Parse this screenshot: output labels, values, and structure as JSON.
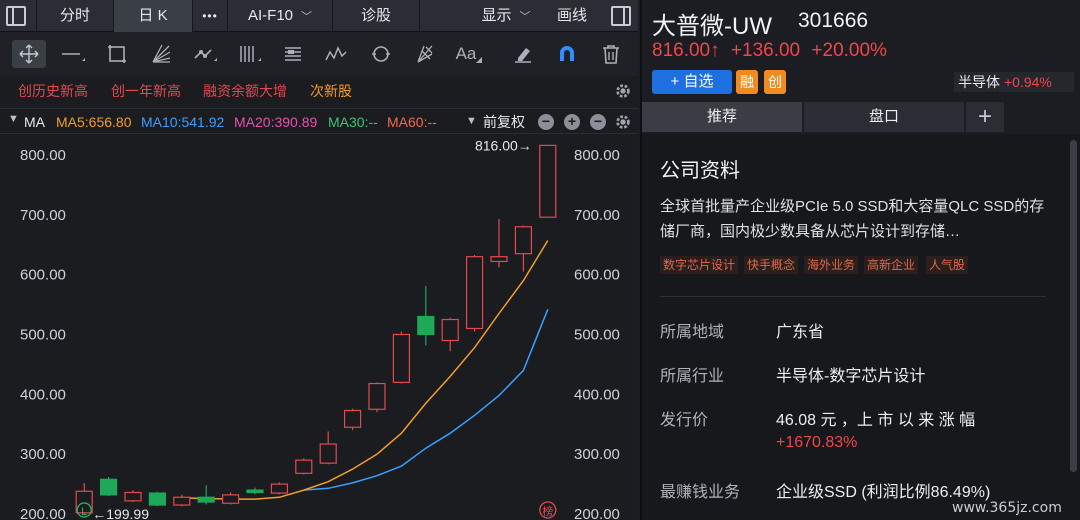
{
  "topbar": {
    "tab_intraday": "分时",
    "tab_daily": "日 K",
    "more": "•••",
    "tab_f10": "AI-F10",
    "tab_diagnose": "诊股",
    "display": "显示",
    "draw": "画线"
  },
  "toolbar": {
    "icons": [
      "crosshair-icon",
      "line-icon",
      "rect-icon",
      "fan-icon",
      "channel-icon",
      "parallel-icon",
      "fib-icon",
      "wave-icon",
      "cycle-icon",
      "gann-icon",
      "text-icon",
      "eraser-icon",
      "magnet-icon",
      "trash-icon"
    ]
  },
  "tags": [
    "创历史新高",
    "创一年新高",
    "融资余额大增",
    "次新股"
  ],
  "ma": {
    "label": "MA",
    "ma5": "MA5:656.80",
    "ma10": "MA10:541.92",
    "ma20": "MA20:390.89",
    "ma30": "MA30:--",
    "ma60": "MA60:--",
    "adjust": "前复权",
    "colors": {
      "ma5": "#f39c2c",
      "ma10": "#3aa0ff",
      "ma20": "#e84fae",
      "ma30": "#3fc27b",
      "ma60": "#f06b4e"
    }
  },
  "chart_data": {
    "type": "candlestick",
    "y_ticks": [
      "800.00",
      "700.00",
      "600.00",
      "500.00",
      "400.00",
      "300.00",
      "200.00"
    ],
    "ylim": [
      190,
      835
    ],
    "high_label": "816.00",
    "low_label": "199.99",
    "candles": [
      {
        "o": 202,
        "c": 238,
        "h": 252,
        "l": 200
      },
      {
        "o": 258,
        "c": 232,
        "h": 262,
        "l": 230
      },
      {
        "o": 222,
        "c": 236,
        "h": 240,
        "l": 220
      },
      {
        "o": 235,
        "c": 215,
        "h": 237,
        "l": 213
      },
      {
        "o": 215,
        "c": 228,
        "h": 232,
        "l": 213
      },
      {
        "o": 228,
        "c": 220,
        "h": 248,
        "l": 216
      },
      {
        "o": 218,
        "c": 232,
        "h": 236,
        "l": 216
      },
      {
        "o": 240,
        "c": 236,
        "h": 244,
        "l": 233
      },
      {
        "o": 235,
        "c": 250,
        "h": 253,
        "l": 233
      },
      {
        "o": 268,
        "c": 290,
        "h": 293,
        "l": 266
      },
      {
        "o": 285,
        "c": 317,
        "h": 338,
        "l": 283
      },
      {
        "o": 345,
        "c": 373,
        "h": 376,
        "l": 340
      },
      {
        "o": 375,
        "c": 418,
        "h": 420,
        "l": 370
      },
      {
        "o": 420,
        "c": 500,
        "h": 505,
        "l": 418
      },
      {
        "o": 530,
        "c": 500,
        "h": 581,
        "l": 482
      },
      {
        "o": 490,
        "c": 525,
        "h": 528,
        "l": 472
      },
      {
        "o": 510,
        "c": 630,
        "h": 633,
        "l": 505
      },
      {
        "o": 622,
        "c": 630,
        "h": 693,
        "l": 612
      },
      {
        "o": 635,
        "c": 680,
        "h": 682,
        "l": 605
      },
      {
        "o": 696,
        "c": 816,
        "h": 816,
        "l": 696
      }
    ],
    "ma5": [
      null,
      null,
      null,
      null,
      227,
      226,
      225,
      225,
      228,
      240,
      254,
      275,
      300,
      335,
      385,
      430,
      478,
      535,
      590,
      657
    ],
    "ma10": [
      null,
      null,
      null,
      null,
      null,
      null,
      null,
      null,
      null,
      240,
      243,
      252,
      264,
      280,
      310,
      335,
      365,
      398,
      440,
      542
    ],
    "colors": {
      "up": "#e5484d",
      "down": "#1fa857",
      "ma5": "#f39c2c",
      "ma10": "#3aa0ff"
    },
    "markers": {
      "left": "L",
      "right": "榜"
    }
  },
  "stock": {
    "name": "大普微-UW",
    "code": "301666",
    "price": "816.00↑",
    "change": "+136.00",
    "pct": "+20.00%",
    "add_fav": "+ 自选",
    "badge_margin": "融",
    "badge_gem": "创",
    "sector": "半导体",
    "sector_pct": "+0.94%"
  },
  "tabs": {
    "recommend": "推荐",
    "orderbook": "盘口",
    "add": "+"
  },
  "company": {
    "title": "公司资料",
    "desc": "全球首批量产企业级PCIe 5.0 SSD和大容量QLC SSD的存储厂商，国内极少数具备从芯片设计到存储…",
    "concept_tags": [
      "数字芯片设计",
      "快手概念",
      "海外业务",
      "高新企业",
      "人气股"
    ],
    "region_label": "所属地域",
    "region": "广东省",
    "industry_label": "所属行业",
    "industry": "半导体-数字芯片设计",
    "ipo_label": "发行价",
    "ipo_price": "46.08 元 ，上 市 以 来 涨 幅",
    "ipo_gain": "+1670.83%",
    "profit_label": "最赚钱业务",
    "profit": "企业级SSD (利润比例86.49%)"
  },
  "watermark": "www.365jz.com"
}
